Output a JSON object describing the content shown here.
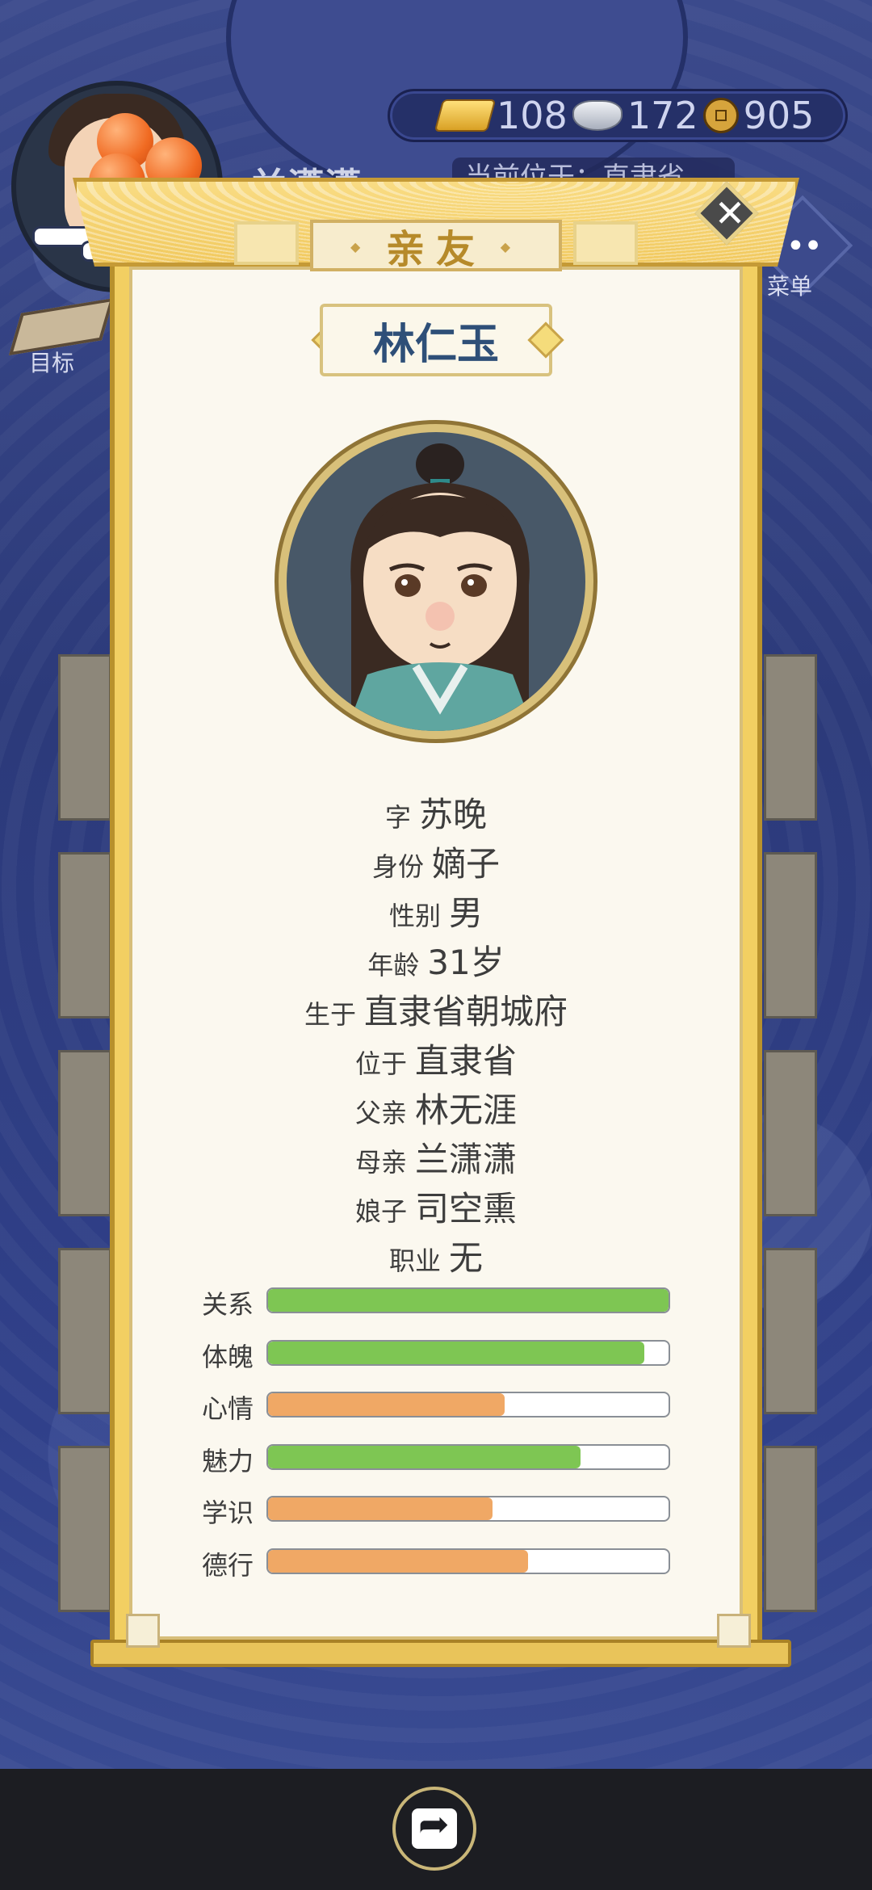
{
  "hud": {
    "gold": "108",
    "silver": "172",
    "coins": "905",
    "player_name": "兰潇潇",
    "location_text": "当前位于：直隶省",
    "menu_label": "菜单",
    "goal_label": "目标"
  },
  "modal": {
    "title": "亲友",
    "character_name": "林仁玉",
    "info": [
      {
        "label": "字",
        "value": "苏晚"
      },
      {
        "label": "身份",
        "value": "嫡子"
      },
      {
        "label": "性别",
        "value": "男"
      },
      {
        "label": "年龄",
        "value": "31岁"
      },
      {
        "label": "生于",
        "value": "直隶省朝城府"
      },
      {
        "label": "位于",
        "value": "直隶省"
      },
      {
        "label": "父亲",
        "value": "林无涯"
      },
      {
        "label": "母亲",
        "value": "兰潇潇"
      },
      {
        "label": "娘子",
        "value": "司空熏"
      },
      {
        "label": "职业",
        "value": "无"
      }
    ],
    "stats": [
      {
        "label": "关系",
        "value": 1.0,
        "color": "#7ec653"
      },
      {
        "label": "体魄",
        "value": 0.94,
        "color": "#7ec653"
      },
      {
        "label": "心情",
        "value": 0.59,
        "color": "#f0a865"
      },
      {
        "label": "魅力",
        "value": 0.78,
        "color": "#7ec653"
      },
      {
        "label": "学识",
        "value": 0.56,
        "color": "#f0a865"
      },
      {
        "label": "德行",
        "value": 0.65,
        "color": "#f0a865"
      }
    ]
  },
  "colors": {
    "bar_green": "#7ec653",
    "bar_orange": "#f0a865",
    "name_blue": "#2e4f78",
    "title_gold": "#b68a2a"
  },
  "icons": {
    "close": "close-icon",
    "share": "share-icon",
    "gold": "gold-ingot-icon",
    "silver": "silver-ingot-icon",
    "coin": "copper-coin-icon"
  }
}
